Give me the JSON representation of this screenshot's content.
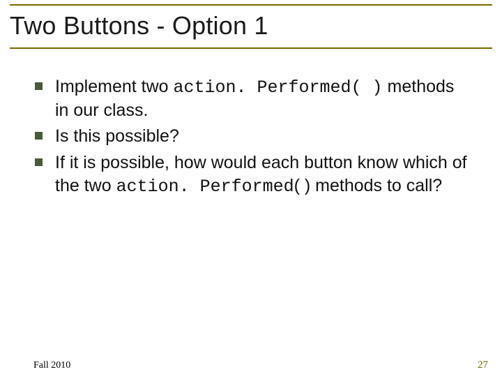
{
  "title": "Two Buttons - Option 1",
  "bullets": [
    {
      "pre": "Implement two ",
      "code": "action. Performed( )",
      "post": " methods in our class."
    },
    {
      "pre": "Is this possible?",
      "code": "",
      "post": ""
    },
    {
      "pre": "If it is possible, how would each button know which of the two ",
      "code": "action. Performed",
      "post": "( ) methods to call?"
    }
  ],
  "footer": {
    "left": "Fall 2010",
    "right": "27"
  }
}
